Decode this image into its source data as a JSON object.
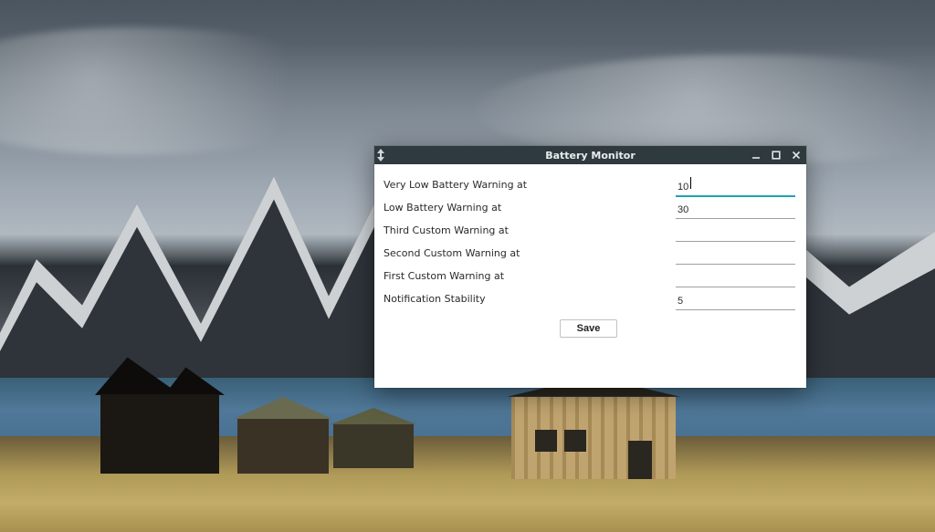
{
  "window": {
    "title": "Battery Monitor",
    "controls": {
      "minimize": "minimize",
      "maximize": "maximize",
      "close": "close"
    }
  },
  "form": {
    "rows": [
      {
        "label": "Very Low Battery Warning at",
        "value": "10",
        "focused": true
      },
      {
        "label": "Low Battery Warning at",
        "value": "30",
        "focused": false
      },
      {
        "label": "Third Custom Warning at",
        "value": "",
        "focused": false
      },
      {
        "label": "Second Custom Warning at",
        "value": "",
        "focused": false
      },
      {
        "label": "First Custom Warning at",
        "value": "",
        "focused": false
      },
      {
        "label": "Notification Stability",
        "value": "5",
        "focused": false
      }
    ],
    "save_label": "Save"
  }
}
